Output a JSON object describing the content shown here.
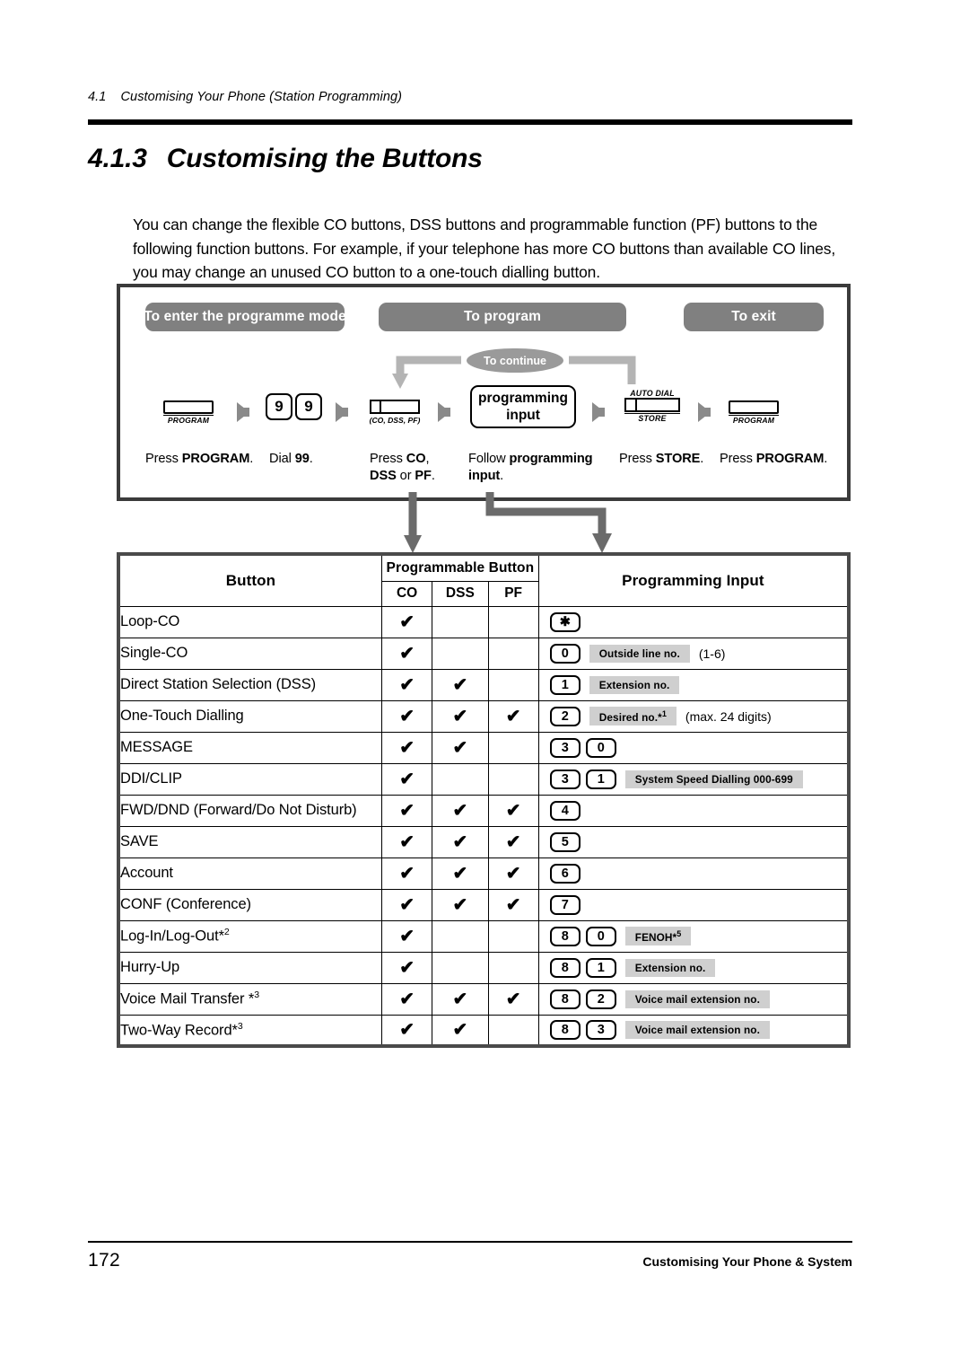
{
  "running_header": {
    "number": "4.1",
    "text": "Customising Your Phone (Station Programming)"
  },
  "section": {
    "number": "4.1.3",
    "title": "Customising the Buttons"
  },
  "intro": "You can change the flexible CO buttons, DSS buttons and programmable function (PF) buttons to the following function buttons. For example, if your telephone has more CO buttons than available CO lines, you may change an unused CO button to a one-touch dialling button.",
  "flow": {
    "pills": {
      "enter": "To enter the programme mode",
      "program": "To program",
      "exit": "To exit"
    },
    "continue_label": "To continue",
    "steps": [
      {
        "key_label": "PROGRAM",
        "caption_pre": "Press ",
        "caption_bold": "PROGRAM",
        "caption_post": "."
      },
      {
        "key_digits": [
          "9",
          "9"
        ],
        "caption_pre": "Dial ",
        "caption_bold": "99",
        "caption_post": "."
      },
      {
        "key_label": "(CO, DSS, PF)",
        "caption_line1_pre": "Press ",
        "caption_line1_bold": "CO",
        "caption_line1_post": ",",
        "caption_line2_bold1": "DSS",
        "caption_line2_mid": " or ",
        "caption_line2_bold2": "PF",
        "caption_line2_post": "."
      },
      {
        "box_line1": "programming",
        "box_line2": "input",
        "caption_pre": "Follow ",
        "caption_bold": "programming",
        "caption_line2_bold": "input",
        "caption_post": "."
      },
      {
        "key_top": "AUTO DIAL",
        "key_bottom": "STORE",
        "caption_pre": "Press ",
        "caption_bold": "STORE",
        "caption_post": "."
      },
      {
        "key_label": "PROGRAM",
        "caption_pre": "Press ",
        "caption_bold": "PROGRAM",
        "caption_post": "."
      }
    ]
  },
  "table": {
    "headers": {
      "button": "Button",
      "programmable_button": "Programmable Button",
      "co": "CO",
      "dss": "DSS",
      "pf": "PF",
      "programming_input": "Programming Input"
    },
    "rows": [
      {
        "name": "Loop-CO",
        "sup": "",
        "co": true,
        "dss": false,
        "pf": false,
        "keys": [
          "✱"
        ],
        "grey": "",
        "grey_sup": "",
        "plain": ""
      },
      {
        "name": "Single-CO",
        "sup": "",
        "co": true,
        "dss": false,
        "pf": false,
        "keys": [
          "0"
        ],
        "grey": "Outside line no.",
        "grey_sup": "",
        "plain": "(1-6)"
      },
      {
        "name": "Direct Station Selection (DSS)",
        "sup": "",
        "co": true,
        "dss": true,
        "pf": false,
        "keys": [
          "1"
        ],
        "grey": "Extension no.",
        "grey_sup": "",
        "plain": ""
      },
      {
        "name": "One-Touch  Dialling",
        "sup": "",
        "co": true,
        "dss": true,
        "pf": true,
        "keys": [
          "2"
        ],
        "grey": "Desired no.*",
        "grey_sup": "1",
        "plain": "(max. 24 digits)"
      },
      {
        "name": "MESSAGE",
        "sup": "",
        "co": true,
        "dss": true,
        "pf": false,
        "keys": [
          "3",
          "0"
        ],
        "grey": "",
        "grey_sup": "",
        "plain": ""
      },
      {
        "name": "DDI/CLIP",
        "sup": "",
        "co": true,
        "dss": false,
        "pf": false,
        "keys": [
          "3",
          "1"
        ],
        "grey": "System Speed Dialling  000-699",
        "grey_sup": "",
        "plain": ""
      },
      {
        "name": "FWD/DND (Forward/Do Not Disturb)",
        "sup": "",
        "co": true,
        "dss": true,
        "pf": true,
        "keys": [
          "4"
        ],
        "grey": "",
        "grey_sup": "",
        "plain": ""
      },
      {
        "name": "SAVE",
        "sup": "",
        "co": true,
        "dss": true,
        "pf": true,
        "keys": [
          "5"
        ],
        "grey": "",
        "grey_sup": "",
        "plain": ""
      },
      {
        "name": "Account",
        "sup": "",
        "co": true,
        "dss": true,
        "pf": true,
        "keys": [
          "6"
        ],
        "grey": "",
        "grey_sup": "",
        "plain": ""
      },
      {
        "name": "CONF (Conference)",
        "sup": "",
        "co": true,
        "dss": true,
        "pf": true,
        "keys": [
          "7"
        ],
        "grey": "",
        "grey_sup": "",
        "plain": ""
      },
      {
        "name": "Log-In/Log-Out*",
        "sup": "2",
        "co": true,
        "dss": false,
        "pf": false,
        "keys": [
          "8",
          "0"
        ],
        "grey": "FENOH*",
        "grey_sup": "5",
        "plain": ""
      },
      {
        "name": "Hurry-Up",
        "sup": "",
        "co": true,
        "dss": false,
        "pf": false,
        "keys": [
          "8",
          "1"
        ],
        "grey": "Extension no.",
        "grey_sup": "",
        "plain": ""
      },
      {
        "name": "Voice Mail Transfer *",
        "sup": "3",
        "co": true,
        "dss": true,
        "pf": true,
        "keys": [
          "8",
          "2"
        ],
        "grey": "Voice mail extension no.",
        "grey_sup": "",
        "plain": ""
      },
      {
        "name": "Two-Way  Record*",
        "sup": "3",
        "co": true,
        "dss": true,
        "pf": false,
        "keys": [
          "8",
          "3"
        ],
        "grey": "Voice mail extension no.",
        "grey_sup": "",
        "plain": ""
      }
    ],
    "check_glyph": "✔"
  },
  "footer": {
    "page": "172",
    "text": "Customising Your Phone & System"
  },
  "colors": {
    "pill_grey": "#808080",
    "ellipse_grey": "#9a9a9a",
    "arrow_grey": "#8a8a8a",
    "label_grey": "#cfcfcf",
    "box_border": "#3b3b3b",
    "table_border": "#4a4a4a"
  }
}
